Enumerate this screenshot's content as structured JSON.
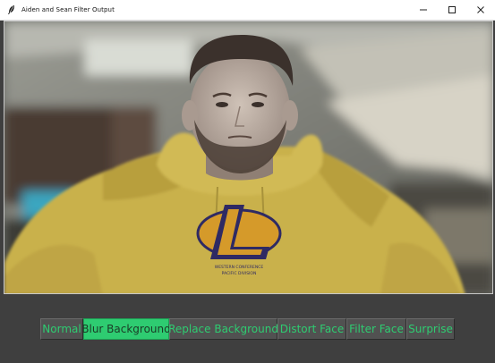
{
  "window": {
    "title": "Aiden and Sean Filter Output",
    "icon": "feather-icon",
    "controls": [
      "minimize-icon",
      "maximize-icon",
      "close-icon"
    ]
  },
  "video": {
    "subject": "webcam feed, blurred background",
    "shirt_text_top": "WESTERN CONFERENCE",
    "shirt_text_bottom": "PACIFIC DIVISION"
  },
  "filters": {
    "buttons": [
      {
        "label": "Normal",
        "active": false
      },
      {
        "label": "Blur Background",
        "active": true
      },
      {
        "label": "Replace Background",
        "active": false
      },
      {
        "label": "Distort Face",
        "active": false
      },
      {
        "label": "Filter Face",
        "active": false
      },
      {
        "label": "Surprise",
        "active": false
      }
    ]
  },
  "colors": {
    "accent": "#2ecc71",
    "panel": "#3f3f3f",
    "button": "#515151"
  }
}
